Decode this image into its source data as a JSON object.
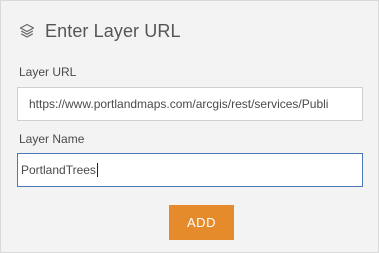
{
  "dialog": {
    "title": "Enter Layer URL",
    "title_icon": "layers-icon"
  },
  "form": {
    "url_label": "Layer URL",
    "url_value": "https://www.portlandmaps.com/arcgis/rest/services/Publi",
    "name_label": "Layer Name",
    "name_value": "PortlandTrees",
    "add_label": "ADD"
  },
  "colors": {
    "accent_button": "#e58b2b",
    "focus_border": "#4c78b8"
  }
}
